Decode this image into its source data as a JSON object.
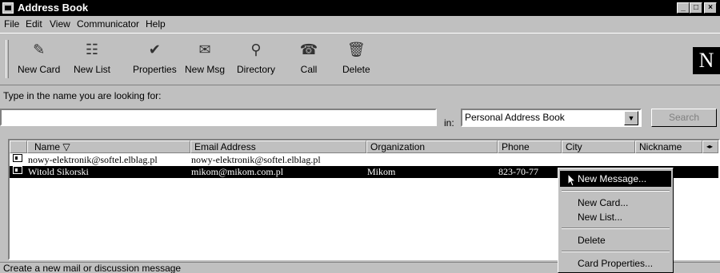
{
  "window": {
    "title": "Address Book",
    "min": "_",
    "max": "□",
    "close": "×"
  },
  "menu": {
    "file": "File",
    "edit": "Edit",
    "view": "View",
    "communicator": "Communicator",
    "help": "Help"
  },
  "toolbar": {
    "new_card": "New Card",
    "new_list": "New List",
    "properties": "Properties",
    "new_msg": "New Msg",
    "directory": "Directory",
    "call": "Call",
    "delete": "Delete",
    "logo": "N"
  },
  "search": {
    "prompt": "Type in the name you are looking for:",
    "value": "",
    "in_label": "in:",
    "book": "Personal Address Book",
    "button": "Search"
  },
  "columns": {
    "name": "Name ▽",
    "email": "Email Address",
    "organization": "Organization",
    "phone": "Phone",
    "city": "City",
    "nickname": "Nickname"
  },
  "rows": [
    {
      "name": "nowy-elektronik@softel.elblag.pl",
      "email": "nowy-elektronik@softel.elblag.pl",
      "organization": "",
      "phone": ""
    },
    {
      "name": "Witold Sikorski",
      "email": "mikom@mikom.com.pl",
      "organization": "Mikom",
      "phone": "823-70-77"
    }
  ],
  "context_menu": {
    "new_message": "New Message...",
    "new_card": "New Card...",
    "new_list": "New List...",
    "delete": "Delete",
    "card_properties": "Card Properties..."
  },
  "status": "Create a new mail or discussion message"
}
